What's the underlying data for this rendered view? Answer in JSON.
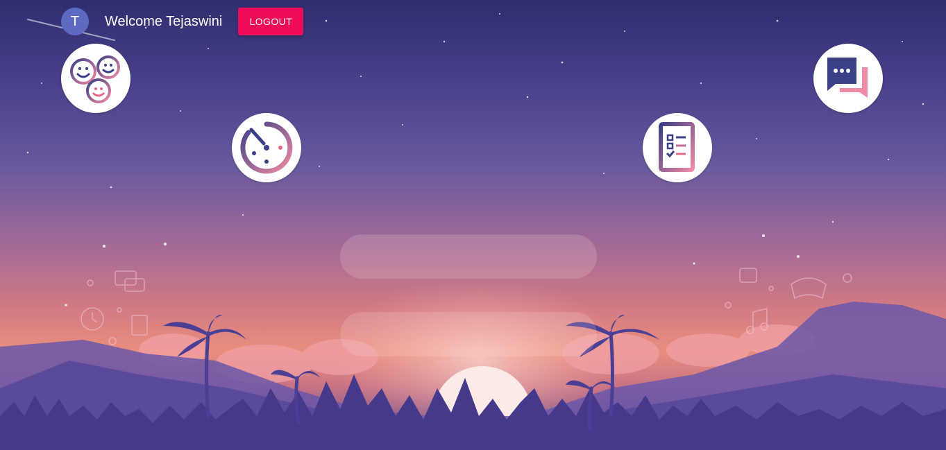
{
  "user": {
    "avatar_initial": "T",
    "welcome_text": "Welcome Tejaswini"
  },
  "header": {
    "logout_label": "LOGOUT"
  },
  "colors": {
    "accent": "#ef0b5a",
    "avatar_bg": "#5c6bc0",
    "icon_dark": "#3b3f86",
    "icon_pink": "#f18aa5"
  },
  "nav_icons": [
    {
      "name": "friends-icon"
    },
    {
      "name": "timer-icon"
    },
    {
      "name": "checklist-icon"
    },
    {
      "name": "chat-icon"
    }
  ]
}
